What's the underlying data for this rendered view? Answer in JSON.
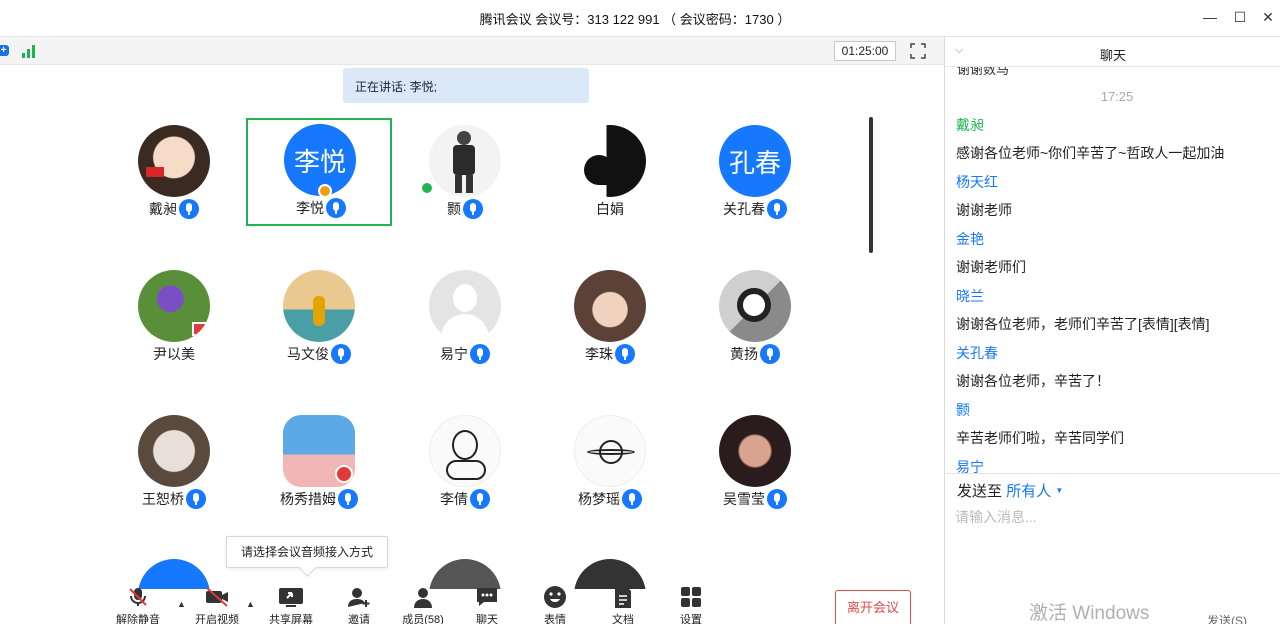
{
  "title": "腾讯会议 会议号：313 122 991 （ 会议密码：1730 ）",
  "window_controls": {
    "minimize": "—",
    "maximize": "☐",
    "close": "✕"
  },
  "status": {
    "timer": "01:25:00"
  },
  "speaking": "正在讲话: 李悦;",
  "participants": [
    {
      "name": "戴昶",
      "mic": true
    },
    {
      "name": "李悦",
      "mic": true,
      "initials": "李悦"
    },
    {
      "name": "颢",
      "mic": true
    },
    {
      "name": "白娟",
      "mic": false
    },
    {
      "name": "关孔春",
      "mic": true,
      "initials": "孔春"
    },
    {
      "name": "尹以美",
      "mic": false
    },
    {
      "name": "马文俊",
      "mic": true
    },
    {
      "name": "易宁",
      "mic": true
    },
    {
      "name": "李珠",
      "mic": true
    },
    {
      "name": "黄扬",
      "mic": true
    },
    {
      "name": "王恕桥",
      "mic": true
    },
    {
      "name": "杨秀措姆",
      "mic": true
    },
    {
      "name": "李倩",
      "mic": true
    },
    {
      "name": "杨梦瑶",
      "mic": true
    },
    {
      "name": "吴雪莹",
      "mic": true
    }
  ],
  "tooltip": "请选择会议音频接入方式",
  "toolbar": {
    "mute": "解除静音",
    "video": "开启视频",
    "share": "共享屏幕",
    "invite": "邀请",
    "members": "成员(58)",
    "chat": "聊天",
    "emoji": "表情",
    "docs": "文档",
    "settings": "设置",
    "leave": "离开会议"
  },
  "chat": {
    "title": "聊天",
    "cut_text": "谢谢数马",
    "time": "17:25",
    "messages": [
      {
        "sender": "戴昶",
        "color": "#21b354",
        "text": "感谢各位老师~你们辛苦了~哲政人一起加油"
      },
      {
        "sender": "杨天红",
        "color": "#1677ff",
        "text": "谢谢老师"
      },
      {
        "sender": "金艳",
        "color": "#1677ff",
        "text": "谢谢老师们"
      },
      {
        "sender": "晓兰",
        "color": "#1677ff",
        "text": "谢谢各位老师，老师们辛苦了[表情][表情]"
      },
      {
        "sender": "关孔春",
        "color": "#1677ff",
        "text": "谢谢各位老师，辛苦了！"
      },
      {
        "sender": "颢",
        "color": "#1677ff",
        "text": "辛苦老师们啦，辛苦同学们"
      },
      {
        "sender": "易宁",
        "color": "#1677ff",
        "text": ""
      }
    ],
    "send_to_label": "发送至",
    "send_to_target": "所有人",
    "input_placeholder": "请输入消息...",
    "send_button": "发送(S)"
  },
  "watermark": "激活 Windows"
}
